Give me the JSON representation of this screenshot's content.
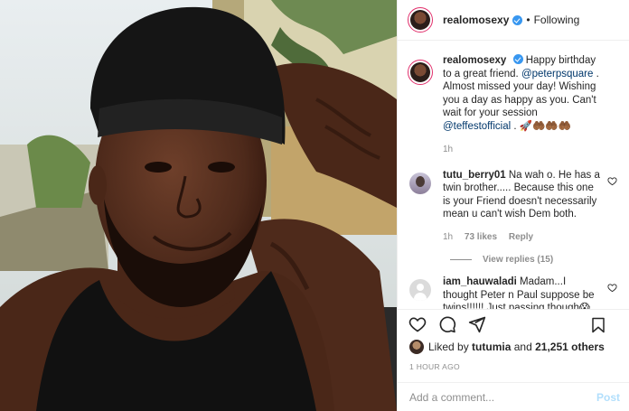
{
  "post_image": {
    "alt": "selfie"
  },
  "header": {
    "username": "realomosexy",
    "separator": "•",
    "follow_label": "Following"
  },
  "caption": {
    "username": "realomosexy",
    "text_1": "Happy birthday to a great friend. ",
    "mention_1": "@peterpsquare",
    "text_2": " . Almost missed your day! Wishing you a day as happy as you. Can't wait for your session ",
    "mention_2": "@teffestofficial",
    "text_3": " . 🚀🤲🏾🤲🏾🤲🏾",
    "time": "1h"
  },
  "comments": [
    {
      "username": "tutu_berry01",
      "text": "Na wah o. He has a twin brother..... Because this one is your Friend doesn't necessarily mean u can't wish Dem both.",
      "time": "1h",
      "likes": "73 likes",
      "reply": "Reply",
      "view_replies": "View replies (15)"
    },
    {
      "username": "iam_hauwaladi",
      "text": "Madam...I thought Peter n Paul suppose be twins!!!!!! Just passing though😱"
    }
  ],
  "likes": {
    "prefix": "Liked by ",
    "user": "tutumia",
    "middle": " and ",
    "count": "21,251 others"
  },
  "timestamp": "1 HOUR AGO",
  "add_comment": {
    "placeholder": "Add a comment...",
    "post_label": "Post"
  },
  "icons": [
    "heart-icon",
    "comment-icon",
    "share-icon",
    "bookmark-icon",
    "verified-icon"
  ],
  "colors": {
    "verified": "#3897f0",
    "mention": "#00376b",
    "post_disabled": "#b2dffc",
    "muted": "#8e8e8e"
  }
}
